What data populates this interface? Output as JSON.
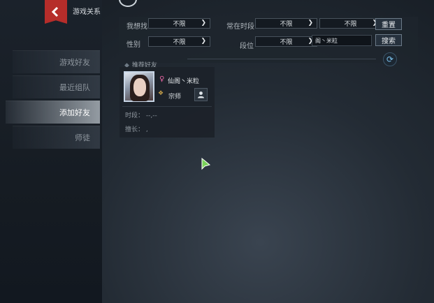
{
  "header": {
    "title": "游戏关系"
  },
  "nav": {
    "items": [
      {
        "label": "游戏好友"
      },
      {
        "label": "最近组队"
      },
      {
        "label": "添加好友",
        "active": true
      },
      {
        "label": "师徒"
      }
    ]
  },
  "filters": {
    "want_label": "我想找",
    "want_value": "不限",
    "time_label": "常在时段",
    "time_value_1": "不限",
    "time_value_2": "不限",
    "reset_label": "重置",
    "gender_label": "性别",
    "gender_value": "不限",
    "rank_label": "段位",
    "rank_value": "不限",
    "name_value": "阁丶米粒",
    "search_label": "搜索"
  },
  "recommend": {
    "label": "推荐好友"
  },
  "card": {
    "name": "仙阁丶米粒",
    "rank": "宗师",
    "time_label": "时段：",
    "time_value": "--,--",
    "skill_label": "擅长：",
    "skill_value": ","
  },
  "colors": {
    "accent_red": "#b62d2a",
    "refresh_blue": "#7cc3ef",
    "gender_pink": "#e865a3"
  }
}
